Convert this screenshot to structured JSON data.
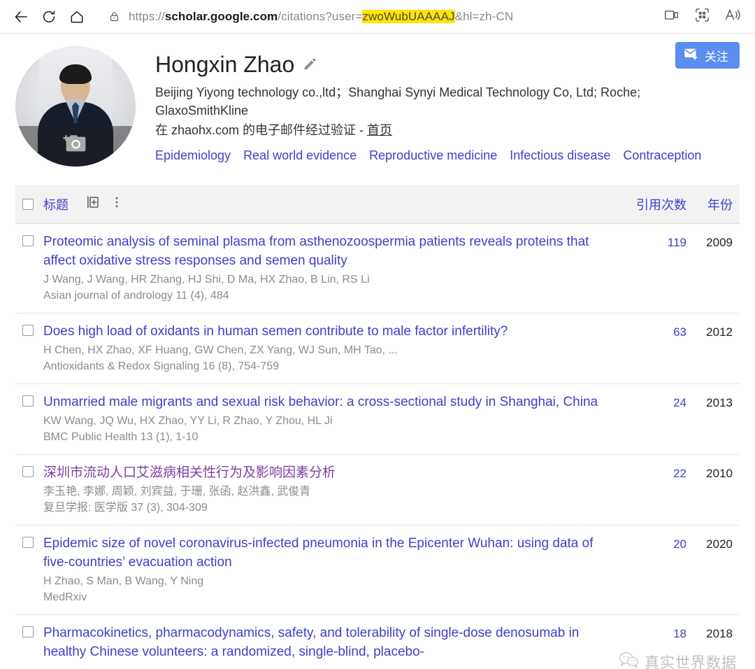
{
  "browser": {
    "back_label": "Back",
    "refresh_label": "Refresh",
    "home_label": "Home",
    "url_prefix": "https://",
    "url_host": "scholar.google.com",
    "url_path": "/citations?user=",
    "url_highlighted": "zwoWubUAAAAJ",
    "url_suffix": "&hl=zh-CN",
    "lock_icon": "lock-icon",
    "device_icon": "cast-device-icon",
    "collections_icon": "collections-grid-icon",
    "read_aloud_icon": "read-aloud-icon"
  },
  "profile": {
    "name": "Hongxin Zhao",
    "edit_icon": "pencil-edit-icon",
    "affiliation": "Beijing Yiyong technology co.,ltd；Shanghai Synyi Medical Technology Co, Ltd; Roche; GlaxoSmithKline",
    "verified_text": "在 zhaohx.com 的电子邮件经过验证 - ",
    "homepage_label": "首页",
    "interests": [
      "Epidemiology",
      "Real world evidence",
      "Reproductive medicine",
      "Infectious disease",
      "Contraception"
    ],
    "avatar_camera_icon": "camera-upload-icon"
  },
  "follow": {
    "label": "关注",
    "icon": "mail-follow-icon",
    "color": "#5b8def"
  },
  "table": {
    "select_all_label": "select-all",
    "title_header": "标题",
    "add_icon": "add-to-library-icon",
    "more_icon": "more-vertical-icon",
    "cites_header": "引用次数",
    "year_header": "年份"
  },
  "articles": [
    {
      "title": "Proteomic analysis of seminal plasma from asthenozoospermia patients reveals proteins that affect oxidative stress responses and semen quality",
      "authors": "J Wang, J Wang, HR Zhang, HJ Shi, D Ma, HX Zhao, B Lin, RS Li",
      "venue": "Asian journal of andrology 11 (4), 484",
      "cites": "119",
      "year": "2009",
      "visited": false
    },
    {
      "title": "Does high load of oxidants in human semen contribute to male factor infertility?",
      "authors": "H Chen, HX Zhao, XF Huang, GW Chen, ZX Yang, WJ Sun, MH Tao, ...",
      "venue": "Antioxidants & Redox Signaling 16 (8), 754-759",
      "cites": "63",
      "year": "2012",
      "visited": false
    },
    {
      "title": "Unmarried male migrants and sexual risk behavior: a cross-sectional study in Shanghai, China",
      "authors": "KW Wang, JQ Wu, HX Zhao, YY Li, R Zhao, Y Zhou, HL Ji",
      "venue": "BMC Public Health 13 (1), 1-10",
      "cites": "24",
      "year": "2013",
      "visited": false
    },
    {
      "title": "深圳市流动人口艾滋病相关性行为及影响因素分析",
      "authors": "李玉艳, 李娜, 周颖, 刘宾益, 于珊, 张函, 赵洪鑫, 武俊青",
      "venue": "复旦学报: 医学版 37 (3), 304-309",
      "cites": "22",
      "year": "2010",
      "visited": true
    },
    {
      "title": "Epidemic size of novel coronavirus-infected pneumonia in the Epicenter Wuhan: using data of five-countries’ evacuation action",
      "authors": "H Zhao, S Man, B Wang, Y Ning",
      "venue": "MedRxiv",
      "cites": "20",
      "year": "2020",
      "visited": false
    },
    {
      "title": "Pharmacokinetics, pharmacodynamics, safety, and tolerability of single-dose denosumab in healthy Chinese volunteers: a randomized, single-blind, placebo-",
      "authors": "",
      "venue": "",
      "cites": "18",
      "year": "2018",
      "visited": false
    }
  ],
  "watermark": {
    "text": "真实世界数据",
    "icon": "wechat-icon"
  }
}
